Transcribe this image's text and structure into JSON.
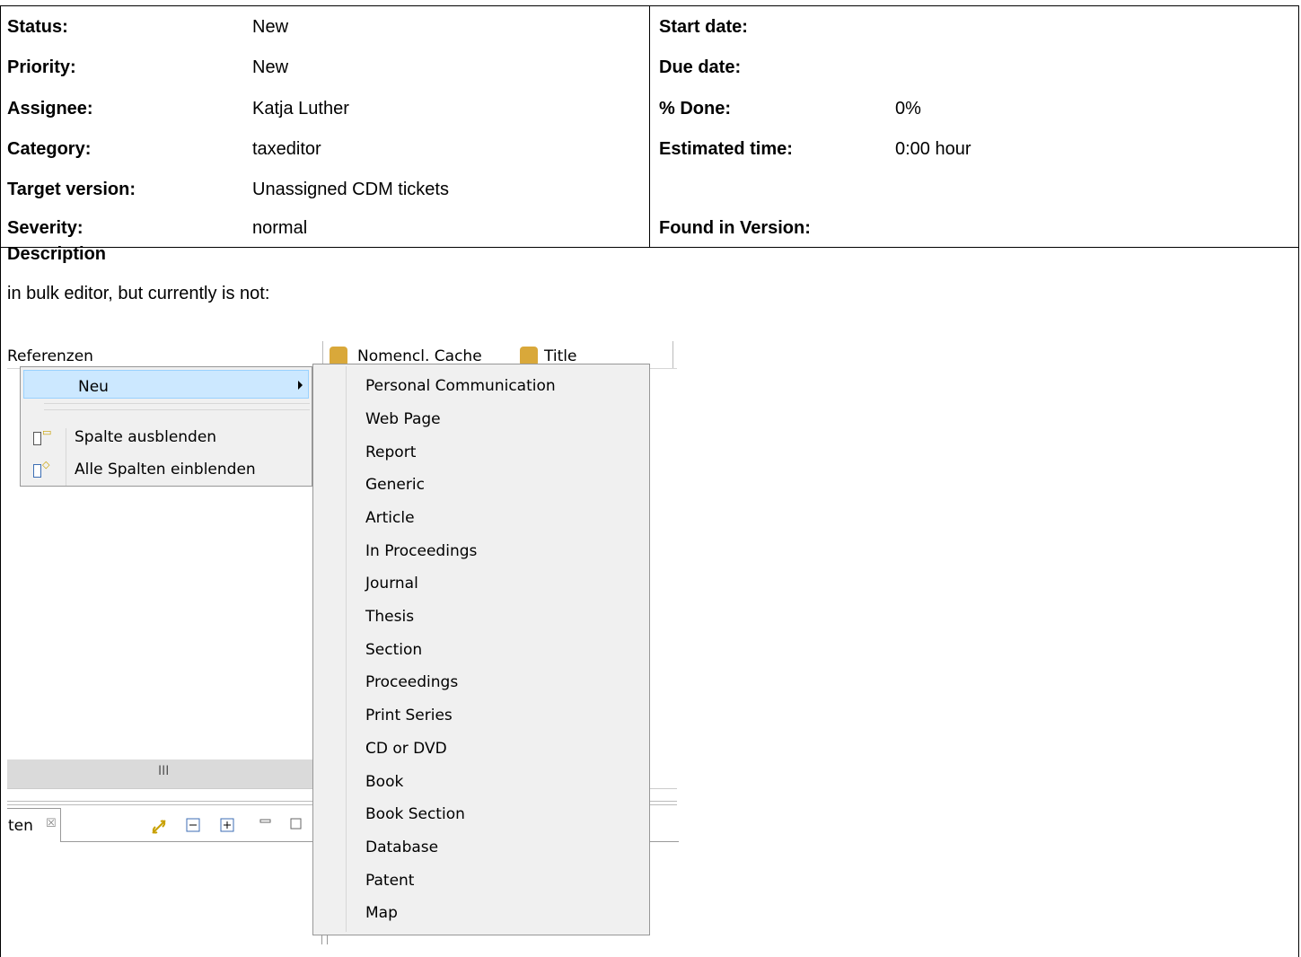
{
  "attributes": {
    "status": {
      "label": "Status:",
      "value": "New"
    },
    "priority": {
      "label": "Priority:",
      "value": "New"
    },
    "assignee": {
      "label": "Assignee:",
      "value": "Katja Luther"
    },
    "category": {
      "label": "Category:",
      "value": "taxeditor"
    },
    "target_version": {
      "label": "Target version:",
      "value": "Unassigned CDM tickets"
    },
    "severity": {
      "label": "Severity:",
      "value": "normal"
    },
    "start_date": {
      "label": "Start date:",
      "value": ""
    },
    "due_date": {
      "label": "Due date:",
      "value": ""
    },
    "done": {
      "label": "% Done:",
      "value": "0%"
    },
    "estimated_time": {
      "label": "Estimated time:",
      "value": "0:00 hour"
    },
    "found_in_version": {
      "label": "Found in Version:",
      "value": ""
    }
  },
  "description": {
    "title": "Description",
    "text": "in bulk editor, but currently is not:"
  },
  "screenshot": {
    "columns": [
      "Referenzen",
      "Nomencl. Cache",
      "Title"
    ],
    "context_menu": {
      "new_label": "Neu",
      "hide_column": "Spalte ausblenden",
      "show_all_columns": "Alle Spalten einblenden"
    },
    "scroll_grip": "III",
    "tab_label": "ten",
    "tab_close": "☒",
    "toolbar_icons": [
      "link-icon",
      "collapse-icon",
      "expand-icon",
      "minimize-icon",
      "maximize-icon"
    ],
    "submenu": [
      "Personal Communication",
      "Web Page",
      "Report",
      "Generic",
      "Article",
      "In Proceedings",
      "Journal",
      "Thesis",
      "Section",
      "Proceedings",
      "Print Series",
      "CD or DVD",
      "Book",
      "Book Section",
      "Database",
      "Patent",
      "Map"
    ]
  }
}
